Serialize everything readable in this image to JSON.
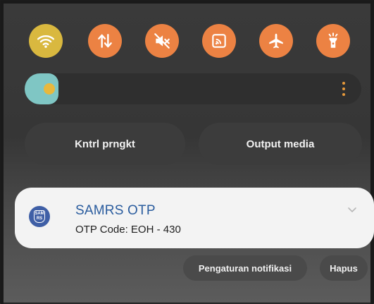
{
  "quick_toggles": [
    {
      "name": "wifi",
      "icon": "wifi-icon",
      "state": "on",
      "color": "#d9b83f"
    },
    {
      "name": "mobile-data",
      "icon": "data-arrows-icon",
      "state": "on",
      "color": "#ec8243"
    },
    {
      "name": "sound",
      "icon": "mute-icon",
      "state": "on",
      "color": "#ec8243"
    },
    {
      "name": "cast",
      "icon": "cast-icon",
      "state": "on",
      "color": "#ec8243"
    },
    {
      "name": "airplane-mode",
      "icon": "airplane-icon",
      "state": "on",
      "color": "#ec8243"
    },
    {
      "name": "flashlight",
      "icon": "flashlight-icon",
      "state": "on",
      "color": "#ec8243"
    }
  ],
  "brightness": {
    "level": 0.1,
    "fill_color": "#7fc6c4",
    "icon": "sun-icon",
    "menu_icon": "more-vertical-icon"
  },
  "panel_buttons": {
    "device_control": "Kntrl prngkt",
    "media_output": "Output media"
  },
  "notification": {
    "app_icon": "samrs-logo-icon",
    "title": "SAMRS OTP",
    "body": "OTP Code: EOH - 430",
    "expand_icon": "chevron-down-icon"
  },
  "notification_actions": {
    "settings": "Pengaturan notifikasi",
    "clear": "Hapus"
  }
}
